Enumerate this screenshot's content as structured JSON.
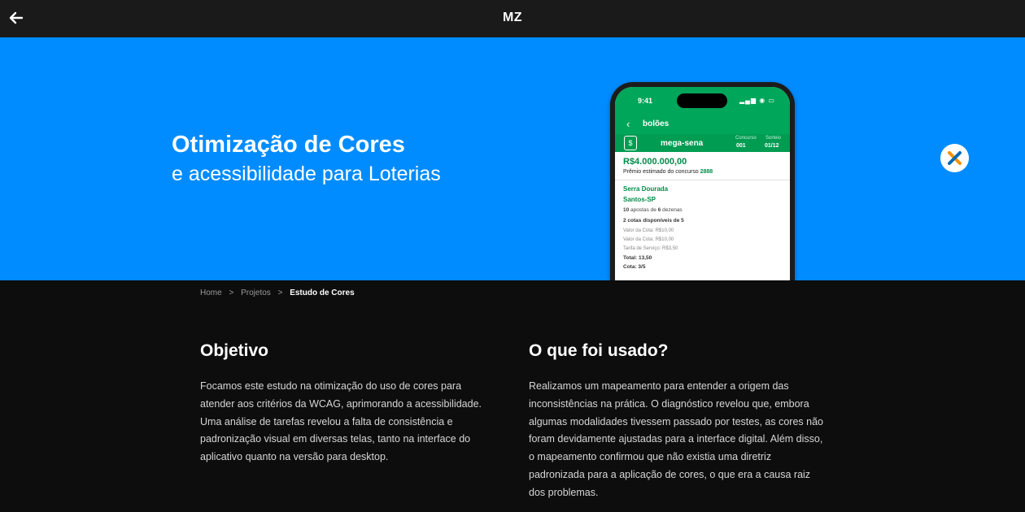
{
  "header": {
    "logo": "MZ",
    "back_icon": "arrow-left-icon"
  },
  "hero": {
    "title": "Otimização de Cores",
    "subtitle": "e acessibilidade para Loterias",
    "background": "#008cff",
    "badge_icon": "caixa-x-logo"
  },
  "phone": {
    "time": "9:41",
    "status": "▂▄▆ ◉ ▭",
    "nav_back": "‹",
    "nav_title": "bolões",
    "game": "mega-sena",
    "concurso_label": "Concurso",
    "concurso_value": "001",
    "sorteio_label": "Sorteio",
    "sorteio_value": "01/12",
    "prize": "R$4.000.000,00",
    "prize_note": "Prêmio estimado do concurso",
    "prize_number": "2888",
    "place_line1": "Serra Dourada",
    "place_line2": "Santos-SP",
    "bets_num": "10",
    "bets_text": "apostas de",
    "bets_num2": "6",
    "bets_text2": "dezenas",
    "cotas": "2 cotas disponíveis de 5",
    "valor_cota1": "Valor da Cota: R$10,00",
    "valor_cota2": "Valor da Cota: R$10,00",
    "tarifa": "Tarifa de Serviço: R$3,50",
    "total": "Total: 13,50",
    "cota": "Cota: 3/5",
    "accent": "#00a65a"
  },
  "breadcrumb": {
    "home": "Home",
    "sep1": ">",
    "projects": "Projetos",
    "sep2": ">",
    "current": "Estudo de Cores"
  },
  "objetivo": {
    "title": "Objetivo",
    "lines": [
      "Focamos este estudo na otimização do uso de cores para",
      "atender aos critérios da WCAG, aprimorando a acessibilidade.",
      "Uma análise de tarefas revelou a falta de consistência e",
      "padronização visual em diversas telas, tanto na interface do",
      "aplicativo quanto na versão para desktop."
    ]
  },
  "usado": {
    "title": "O que foi usado?",
    "lines": [
      "Realizamos um mapeamento para entender a origem das",
      "inconsistências na prática. O diagnóstico revelou que, embora",
      "algumas modalidades tivessem passado por testes, as cores não",
      "foram devidamente ajustadas para a interface digital. Além disso,",
      "o mapeamento confirmou que não existia uma diretriz",
      "padronizada para a aplicação de cores, o que era a causa raiz",
      "dos problemas."
    ]
  }
}
